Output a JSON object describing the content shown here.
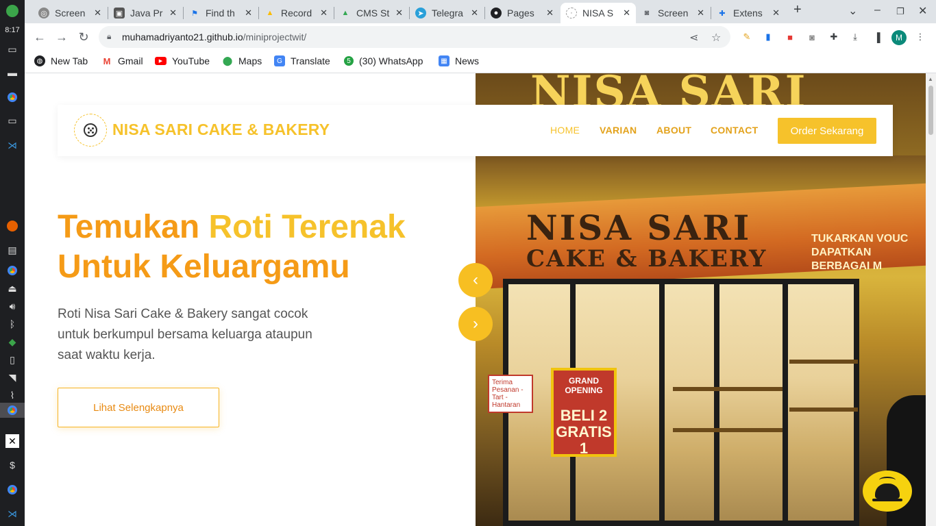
{
  "os": {
    "clock": "8:17"
  },
  "browser": {
    "tabs": [
      {
        "label": "Screen",
        "icon": "chatgpt-icon"
      },
      {
        "label": "Java Pr",
        "icon": "image-icon"
      },
      {
        "label": "Find th",
        "icon": "flag-icon"
      },
      {
        "label": "Record",
        "icon": "google-drive-icon"
      },
      {
        "label": "CMS St",
        "icon": "google-drive-icon"
      },
      {
        "label": "Telegra",
        "icon": "telegram-icon"
      },
      {
        "label": "Pages",
        "icon": "github-icon"
      },
      {
        "label": "NISA S",
        "icon": "cookie-icon",
        "active": true
      },
      {
        "label": "Screen",
        "icon": "camera-icon"
      },
      {
        "label": "Extens",
        "icon": "puzzle-icon"
      }
    ],
    "url_host": "muhamadriyanto21.github.io",
    "url_path": "/miniprojectwit/",
    "profile_initial": "M",
    "bookmarks": [
      {
        "label": "New Tab",
        "icon": "globe-icon"
      },
      {
        "label": "Gmail",
        "icon": "gmail-icon"
      },
      {
        "label": "YouTube",
        "icon": "youtube-icon"
      },
      {
        "label": "Maps",
        "icon": "maps-icon"
      },
      {
        "label": "Translate",
        "icon": "translate-icon"
      },
      {
        "label": "(30) WhatsApp",
        "icon": "whatsapp-icon"
      },
      {
        "label": "News",
        "icon": "news-icon"
      }
    ]
  },
  "site": {
    "brand": "NISA SARI CAKE & BAKERY",
    "nav": [
      "HOME",
      "VARIAN",
      "ABOUT",
      "CONTACT"
    ],
    "order_button": "Order Sekarang",
    "hero_title_part1": "Temukan",
    "hero_title_accent": "Roti Terenak",
    "hero_title_part2": "Untuk Keluargamu",
    "hero_description": "Roti Nisa Sari Cake & Bakery sangat cocok untuk berkumpul bersama keluarga ataupun saat waktu kerja.",
    "cta_button": "Lihat Selengkapnya",
    "photo": {
      "sign_top": "NISA SARI",
      "banner_line1": "NISA SARI",
      "banner_line2": "CAKE & BAKERY",
      "banner_right": "TUKARKAN VOUC DAPATKAN BERBAGAI M",
      "poster_top": "GRAND OPENING",
      "poster_main": "BELI 2 GRATIS 1",
      "small_sign": "Terima Pesanan - Tart - Hantaran"
    }
  },
  "colors": {
    "accent": "#f6c22b",
    "accent_dark": "#f59b17",
    "float_button": "#f6d20f"
  }
}
